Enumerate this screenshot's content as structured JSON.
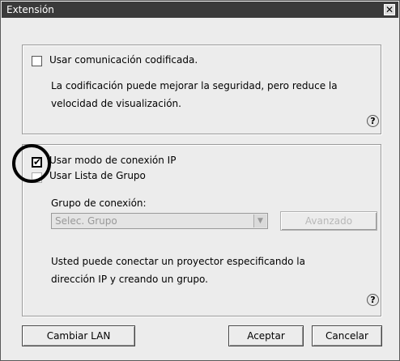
{
  "window": {
    "title": "Extensión",
    "close_glyph": "✕"
  },
  "encryption": {
    "checkbox_label": "Usar comunicación codificada.",
    "checked": false,
    "description_line1": "La codificación puede mejorar la seguridad, pero reduce la",
    "description_line2": "velocidad de visualización.",
    "help": "?"
  },
  "ip_connection": {
    "ip_mode_label": "Usar modo de conexión IP",
    "ip_mode_checked": true,
    "group_list_label": "Usar Lista de Grupo",
    "connection_group_label": "Grupo de conexión:",
    "group_select_value": "Selec. Grupo",
    "advanced_button": "Avanzado",
    "description_line1": "Usted puede conectar un proyector especificando la",
    "description_line2": "dirección IP y creando un grupo.",
    "help": "?",
    "check_glyph": "✔",
    "dropdown_glyph": "▼"
  },
  "buttons": {
    "change_lan": "Cambiar LAN",
    "accept": "Aceptar",
    "cancel": "Cancelar"
  }
}
